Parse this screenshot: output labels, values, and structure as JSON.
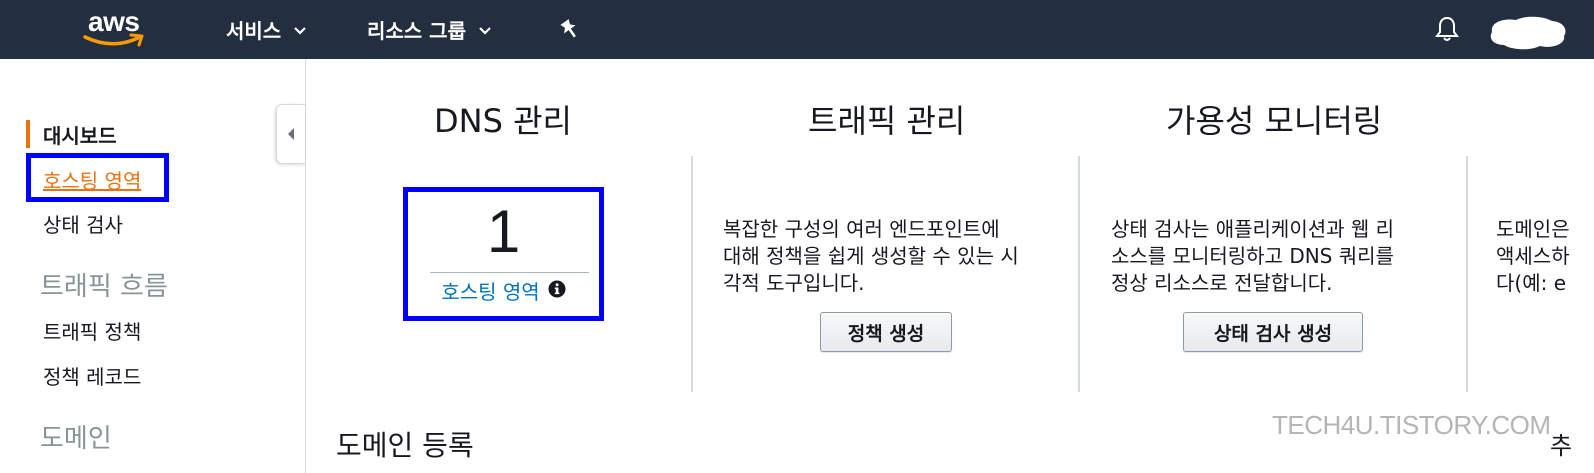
{
  "header": {
    "logo_text": "aws",
    "nav": [
      {
        "label": "서비스"
      },
      {
        "label": "리소스 그룹"
      }
    ],
    "icons": [
      "pin-icon",
      "bell-icon"
    ],
    "colors": {
      "background": "#232f3e",
      "logo_smile": "#ff9900"
    }
  },
  "sidebar": {
    "dashboard": "대시보드",
    "hosted_zones": "호스팅 영역",
    "health_checks": "상태 검사",
    "traffic_flow_heading": "트래픽 흐름",
    "traffic_policies": "트래픽 정책",
    "policy_records": "정책 레코드",
    "domains_heading": "도메인",
    "accent_color": "#ec7211"
  },
  "main": {
    "dns": {
      "title": "DNS 관리",
      "count": "1",
      "link_label": "호스팅 영역"
    },
    "traffic": {
      "title": "트래픽 관리",
      "description": [
        "복잡한 구성의 여러 엔드포인트에",
        "대해 정책을 쉽게 생성할 수 있는 시",
        "각적 도구입니다."
      ],
      "button_label": "정책 생성"
    },
    "availability": {
      "title": "가용성 모니터링",
      "description": [
        "상태 검사는 애플리케이션과 웹 리",
        "소스를 모니터링하고 DNS 쿼리를",
        "정상 리소스로 전달합니다."
      ],
      "button_label": "상태 검사 생성"
    },
    "partial_panel": {
      "lines": [
        "도메인은",
        "액세스하",
        "다(예: e"
      ]
    },
    "domain_registration_heading": "도메인 등록",
    "right_edge_text": "추"
  },
  "watermark": "TECH4U.TISTORY.COM",
  "highlight_color": "#0000ff"
}
